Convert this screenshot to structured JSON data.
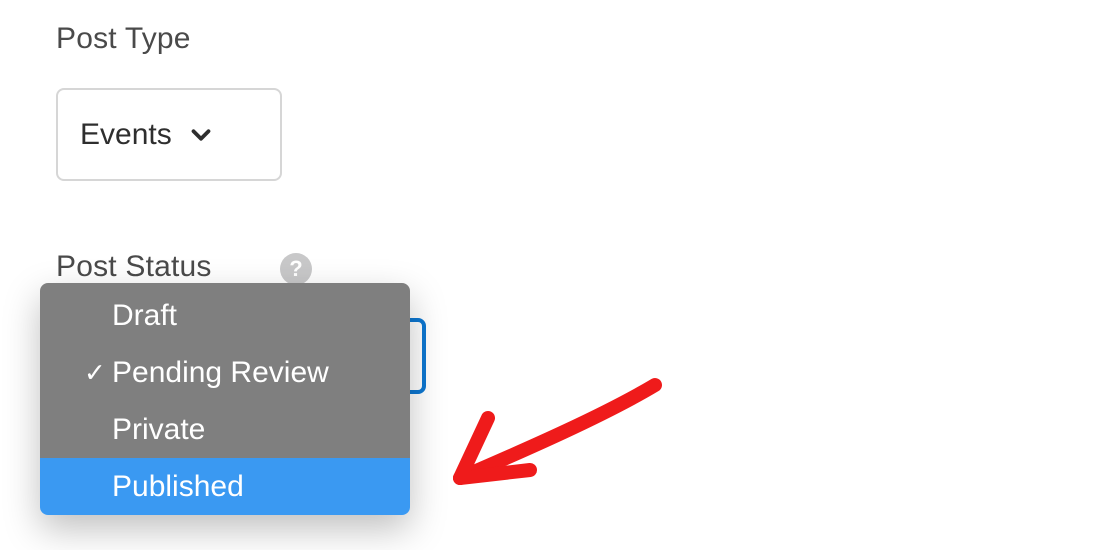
{
  "postType": {
    "label": "Post Type",
    "selected": "Events"
  },
  "postStatus": {
    "label": "Post Status",
    "options": [
      {
        "text": "Draft",
        "checked": false,
        "highlighted": false
      },
      {
        "text": "Pending Review",
        "checked": true,
        "highlighted": false
      },
      {
        "text": "Private",
        "checked": false,
        "highlighted": false
      },
      {
        "text": "Published",
        "checked": false,
        "highlighted": true
      }
    ]
  }
}
